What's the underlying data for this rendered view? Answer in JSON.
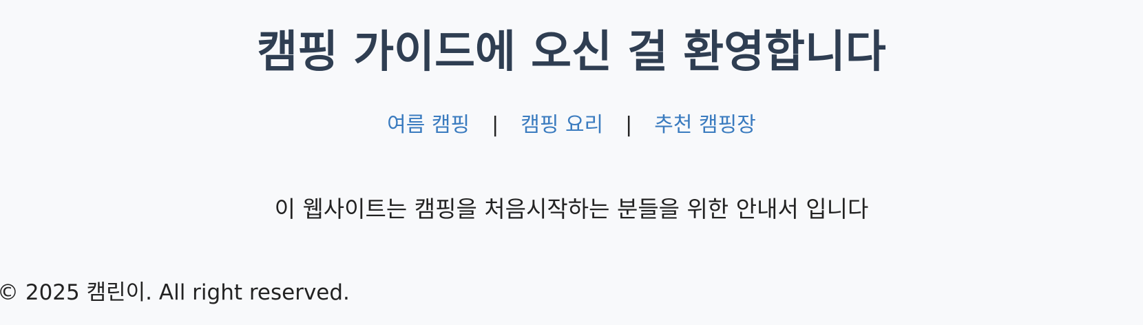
{
  "header": {
    "title": "캠핑 가이드에 오신 걸 환영합니다"
  },
  "nav": {
    "links": [
      {
        "label": "여름 캠핑"
      },
      {
        "label": "캠핑 요리"
      },
      {
        "label": "추천 캠핑장"
      }
    ],
    "separator": "|"
  },
  "main": {
    "intro": "이 웹사이트는 캠핑을 처음시작하는 분들을 위한 안내서 입니다"
  },
  "footer": {
    "copyright": "© 2025 캠린이. All right reserved."
  },
  "colors": {
    "background": "#f8f9fb",
    "title": "#2f3e52",
    "link": "#3a7bbf",
    "text": "#222222"
  }
}
